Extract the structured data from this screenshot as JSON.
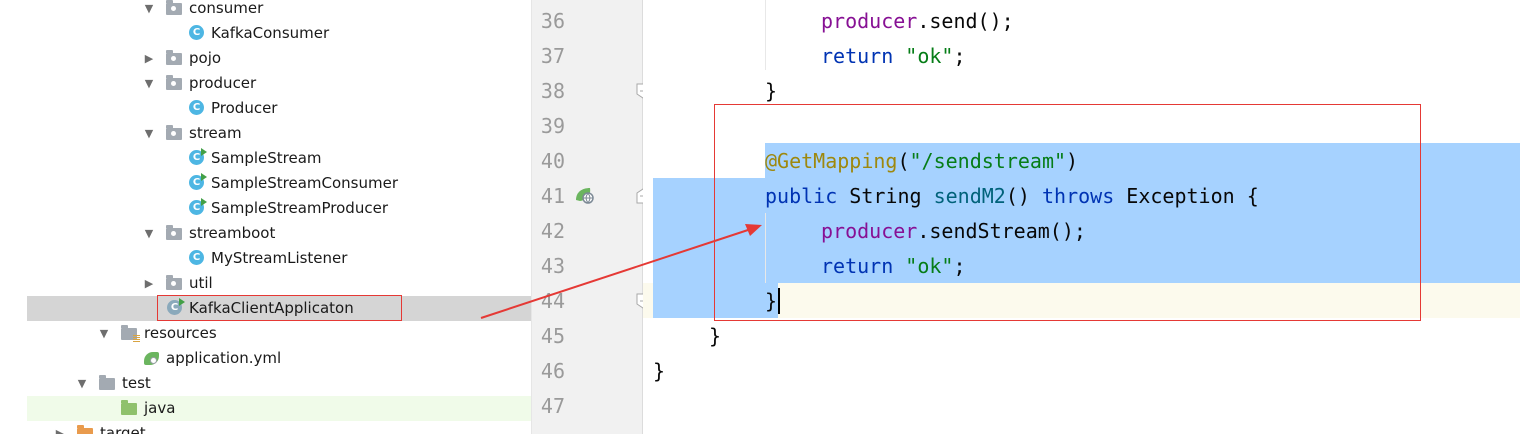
{
  "tree": {
    "items": [
      {
        "label": "consumer",
        "kind": "package",
        "expanded": true
      },
      {
        "label": "KafkaConsumer",
        "kind": "class"
      },
      {
        "label": "pojo",
        "kind": "package",
        "expanded": false
      },
      {
        "label": "producer",
        "kind": "package",
        "expanded": true
      },
      {
        "label": "Producer",
        "kind": "class"
      },
      {
        "label": "stream",
        "kind": "package",
        "expanded": true
      },
      {
        "label": "SampleStream",
        "kind": "runnable-class"
      },
      {
        "label": "SampleStreamConsumer",
        "kind": "runnable-class"
      },
      {
        "label": "SampleStreamProducer",
        "kind": "runnable-class"
      },
      {
        "label": "streamboot",
        "kind": "package",
        "expanded": true
      },
      {
        "label": "MyStreamListener",
        "kind": "class"
      },
      {
        "label": "util",
        "kind": "package",
        "expanded": false
      },
      {
        "label": "KafkaClientApplicaton",
        "kind": "spring-boot-class",
        "selected": true
      },
      {
        "label": "resources",
        "kind": "resources-folder",
        "expanded": true
      },
      {
        "label": "application.yml",
        "kind": "yaml-file"
      },
      {
        "label": "test",
        "kind": "folder",
        "expanded": true
      },
      {
        "label": "java",
        "kind": "test-source-folder"
      },
      {
        "label": "target",
        "kind": "excluded-folder",
        "expanded": false
      }
    ]
  },
  "editor": {
    "line_numbers": [
      "36",
      "37",
      "38",
      "39",
      "40",
      "41",
      "42",
      "43",
      "44",
      "45",
      "46",
      "47"
    ],
    "current_line": "44",
    "code": {
      "l36": {
        "obj": "producer",
        "rest": ".send();"
      },
      "l37": {
        "kw": "return",
        "str": "\"ok\"",
        "end": ";"
      },
      "l38": {
        "text": "}"
      },
      "l40": {
        "ann": "@GetMapping",
        "open": "(",
        "str": "\"/sendstream\"",
        "close": ")"
      },
      "l41": {
        "kw1": "public",
        "type": "String",
        "method": "sendM2",
        "params": "()",
        "kw2": "throws",
        "exc": "Exception",
        "brace": "{"
      },
      "l42": {
        "obj": "producer",
        "rest": ".sendStream();"
      },
      "l43": {
        "kw": "return",
        "str": "\"ok\"",
        "end": ";"
      },
      "l44": {
        "text": "}"
      },
      "l45": {
        "text": "}"
      },
      "l46": {
        "text": "}"
      }
    }
  },
  "colors": {
    "keyword": "#0033b3",
    "field": "#871094",
    "string": "#067d17",
    "annotation": "#9e880d",
    "method": "#00627a",
    "selection": "#a6d2ff",
    "annotation_box": "#e53935"
  },
  "icons": {
    "gutter_marker": "spring-bean-web-endpoint-icon",
    "fold": "fold-marker-icon"
  }
}
